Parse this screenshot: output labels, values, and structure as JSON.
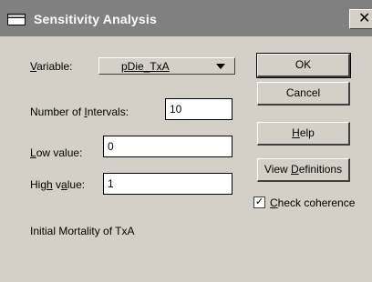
{
  "window": {
    "title": "Sensitivity Analysis",
    "close_glyph": "✕",
    "icon": "window-icon"
  },
  "variable": {
    "label_prefix": "",
    "label_accel": "V",
    "label_rest": "ariable:",
    "selected": "pDie_TxA"
  },
  "intervals": {
    "label_pre": "Number of ",
    "label_accel": "I",
    "label_post": "ntervals:",
    "value": "10"
  },
  "low": {
    "label_accel": "L",
    "label_post": "ow value:",
    "value": "0"
  },
  "high": {
    "label_pre": "Hig",
    "label_accel": "h",
    "label_mid": " v",
    "label_accel2": "a",
    "label_post": "lue:",
    "value": "1"
  },
  "buttons": {
    "ok": "OK",
    "cancel": "Cancel",
    "help_accel": "H",
    "help_rest": "elp",
    "view_pre": "View ",
    "view_accel": "D",
    "view_post": "efinitions"
  },
  "check_coherence": {
    "checked": true,
    "mark": "✓",
    "label_accel": "C",
    "label_rest": "heck coherence"
  },
  "description": "Initial Mortality of TxA"
}
